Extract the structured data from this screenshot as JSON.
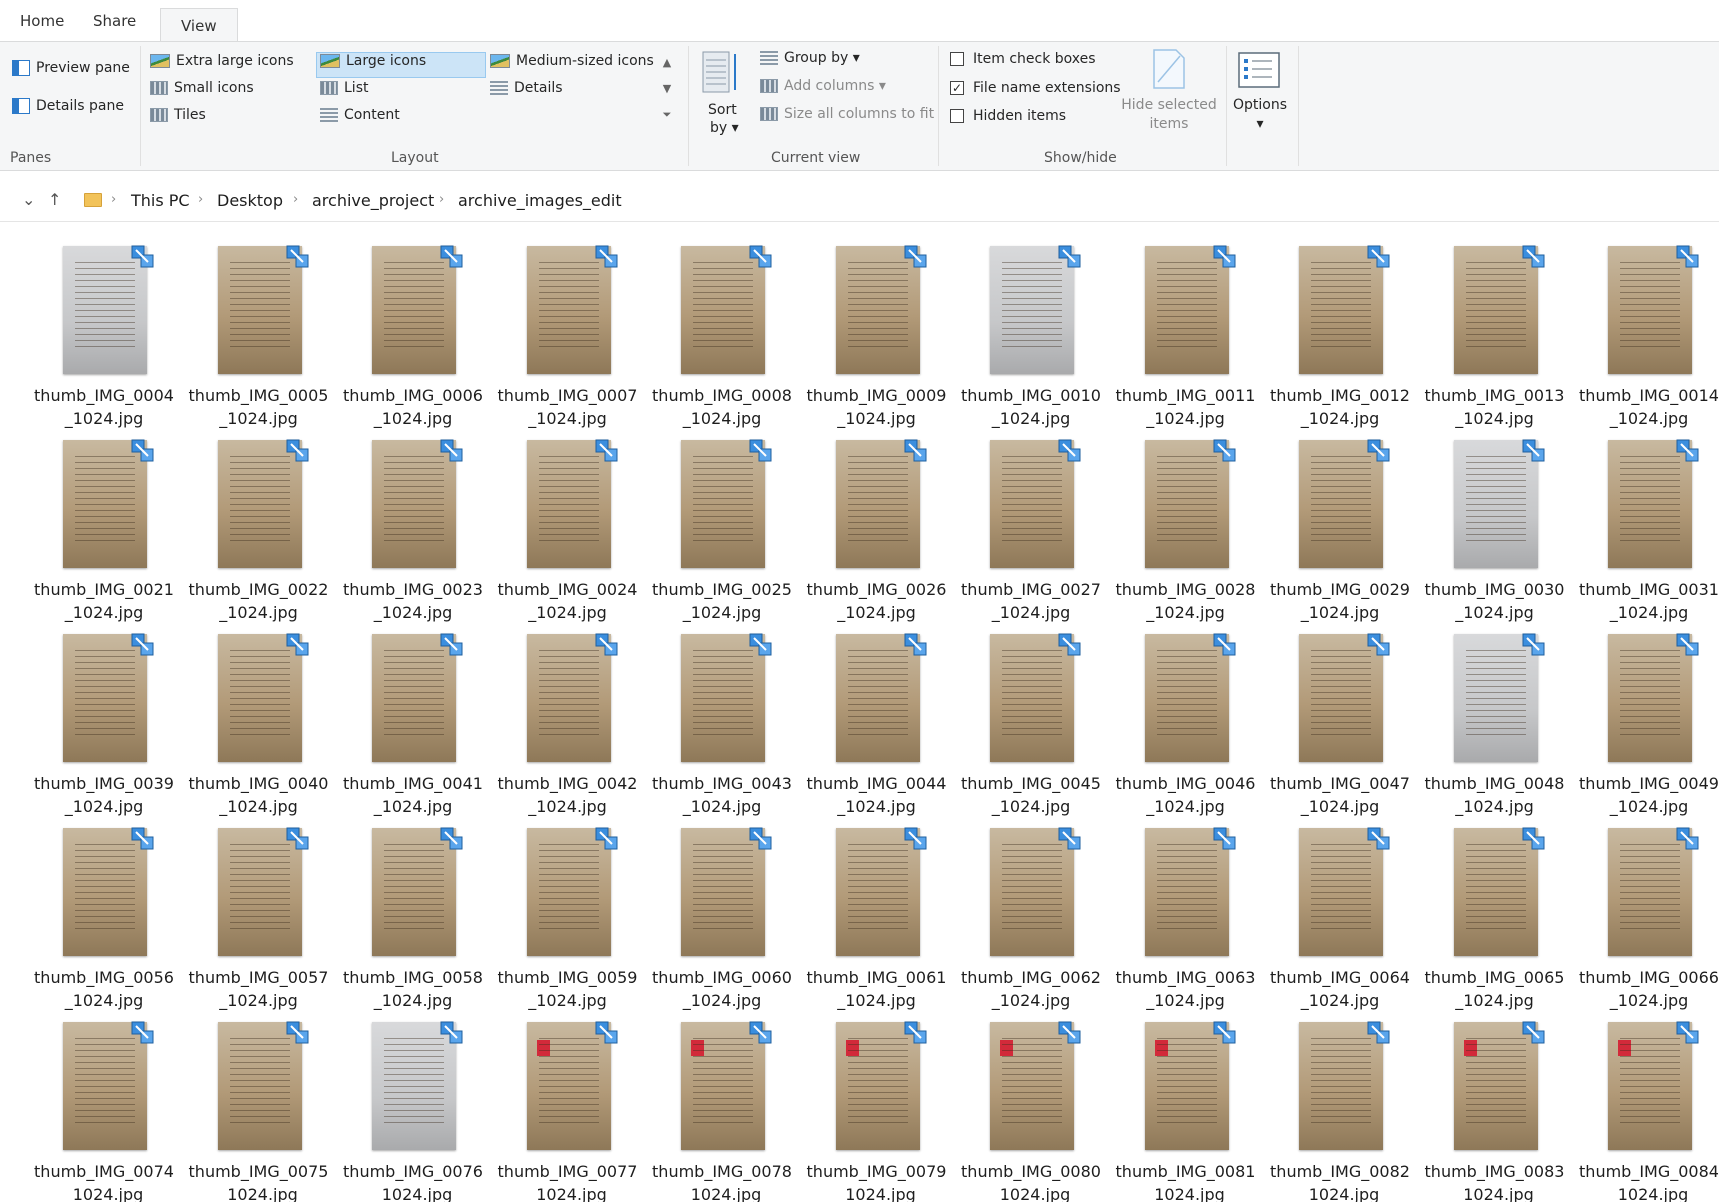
{
  "ribbon_tabs": [
    "Home",
    "Share",
    "View"
  ],
  "panes": {
    "preview_pane": "Preview pane",
    "details_pane": "Details pane",
    "label": "Panes"
  },
  "layout": {
    "extra_large_icons": "Extra large icons",
    "large_icons": "Large icons",
    "medium_icons": "Medium-sized icons",
    "small_icons": "Small icons",
    "list": "List",
    "details": "Details",
    "tiles": "Tiles",
    "content": "Content",
    "label": "Layout",
    "selected": "Large icons"
  },
  "current_view": {
    "sort_by_1": "Sort",
    "sort_by_2": "by",
    "group_by": "Group by",
    "add_columns": "Add columns",
    "size_columns": "Size all columns to fit",
    "label": "Current view"
  },
  "show_hide": {
    "item_check_boxes": "Item check boxes",
    "item_check_boxes_checked": false,
    "file_name_extensions": "File name extensions",
    "file_name_extensions_checked": true,
    "hidden_items": "Hidden items",
    "hidden_items_checked": false,
    "hide_selected_1": "Hide selected",
    "hide_selected_2": "items",
    "label": "Show/hide"
  },
  "options": "Options",
  "breadcrumb": [
    "This PC",
    "Desktop",
    "archive_project",
    "archive_images_edit"
  ],
  "files": [
    [
      "thumb_IMG_0004",
      "thumb_IMG_0005",
      "thumb_IMG_0006",
      "thumb_IMG_0007",
      "thumb_IMG_0008",
      "thumb_IMG_0009",
      "thumb_IMG_0010",
      "thumb_IMG_0011",
      "thumb_IMG_0012",
      "thumb_IMG_0013",
      "thumb_IMG_0014"
    ],
    [
      "thumb_IMG_0021",
      "thumb_IMG_0022",
      "thumb_IMG_0023",
      "thumb_IMG_0024",
      "thumb_IMG_0025",
      "thumb_IMG_0026",
      "thumb_IMG_0027",
      "thumb_IMG_0028",
      "thumb_IMG_0029",
      "thumb_IMG_0030",
      "thumb_IMG_0031"
    ],
    [
      "thumb_IMG_0039",
      "thumb_IMG_0040",
      "thumb_IMG_0041",
      "thumb_IMG_0042",
      "thumb_IMG_0043",
      "thumb_IMG_0044",
      "thumb_IMG_0045",
      "thumb_IMG_0046",
      "thumb_IMG_0047",
      "thumb_IMG_0048",
      "thumb_IMG_0049"
    ],
    [
      "thumb_IMG_0056",
      "thumb_IMG_0057",
      "thumb_IMG_0058",
      "thumb_IMG_0059",
      "thumb_IMG_0060",
      "thumb_IMG_0061",
      "thumb_IMG_0062",
      "thumb_IMG_0063",
      "thumb_IMG_0064",
      "thumb_IMG_0065",
      "thumb_IMG_0066"
    ],
    [
      "thumb_IMG_0074",
      "thumb_IMG_0075",
      "thumb_IMG_0076",
      "thumb_IMG_0077",
      "thumb_IMG_0078",
      "thumb_IMG_0079",
      "thumb_IMG_0080",
      "thumb_IMG_0081",
      "thumb_IMG_0082",
      "thumb_IMG_0083",
      "thumb_IMG_0084"
    ]
  ],
  "file_suffix": "_1024.jpg",
  "grey_thumbnails": [
    "thumb_IMG_0004",
    "thumb_IMG_0010",
    "thumb_IMG_0030",
    "thumb_IMG_0048",
    "thumb_IMG_0076"
  ],
  "red_stamp_thumbnails": [
    "thumb_IMG_0077",
    "thumb_IMG_0078",
    "thumb_IMG_0079",
    "thumb_IMG_0080",
    "thumb_IMG_0081",
    "thumb_IMG_0083",
    "thumb_IMG_0084"
  ],
  "colors": {
    "accent": "#2b79c9",
    "selection": "#cce4f7",
    "ribbon_bg": "#f5f6f7"
  },
  "icons": {
    "badge": "image-link-badge-icon",
    "folder": "folder-icon"
  }
}
